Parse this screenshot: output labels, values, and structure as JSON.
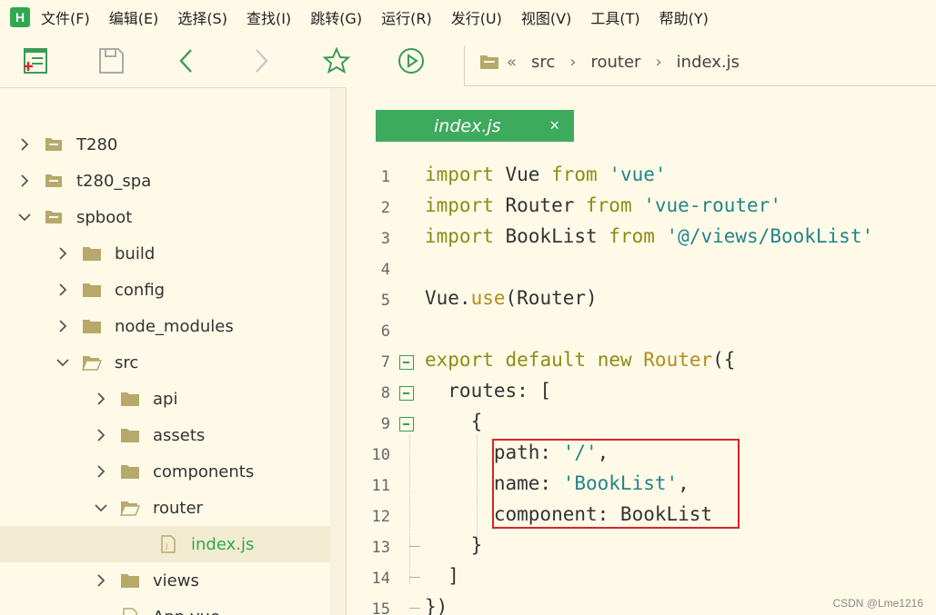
{
  "menu": {
    "logo": "H",
    "items": [
      "文件(F)",
      "编辑(E)",
      "选择(S)",
      "查找(I)",
      "跳转(G)",
      "运行(R)",
      "发行(U)",
      "视图(V)",
      "工具(T)",
      "帮助(Y)"
    ]
  },
  "toolbar": {
    "icons": [
      "new-file-icon",
      "save-icon",
      "back-icon",
      "forward-icon",
      "favorite-star-icon",
      "run-icon"
    ]
  },
  "breadcrumb": {
    "sep_left": "«",
    "items": [
      "src",
      "router",
      "index.js"
    ],
    "sep": "›"
  },
  "tree": [
    {
      "label": "T280",
      "depth": 0,
      "type": "project",
      "expanded": false
    },
    {
      "label": "t280_spa",
      "depth": 0,
      "type": "project",
      "expanded": false
    },
    {
      "label": "spboot",
      "depth": 0,
      "type": "project",
      "expanded": true
    },
    {
      "label": "build",
      "depth": 1,
      "type": "folder",
      "expanded": false
    },
    {
      "label": "config",
      "depth": 1,
      "type": "folder",
      "expanded": false
    },
    {
      "label": "node_modules",
      "depth": 1,
      "type": "folder",
      "expanded": false
    },
    {
      "label": "src",
      "depth": 1,
      "type": "folder",
      "expanded": true
    },
    {
      "label": "api",
      "depth": 2,
      "type": "folder",
      "expanded": false
    },
    {
      "label": "assets",
      "depth": 2,
      "type": "folder",
      "expanded": false
    },
    {
      "label": "components",
      "depth": 2,
      "type": "folder",
      "expanded": false
    },
    {
      "label": "router",
      "depth": 2,
      "type": "folder",
      "expanded": true
    },
    {
      "label": "index.js",
      "depth": 3,
      "type": "file",
      "selected": true
    },
    {
      "label": "views",
      "depth": 2,
      "type": "folder",
      "expanded": false
    },
    {
      "label": "App.vue",
      "depth": 2,
      "type": "file"
    }
  ],
  "tab": {
    "label": "index.js",
    "close": "×"
  },
  "code": {
    "line_numbers": [
      "1",
      "2",
      "3",
      "4",
      "5",
      "6",
      "7",
      "8",
      "9",
      "10",
      "11",
      "12",
      "13",
      "14",
      "15"
    ],
    "l1": [
      "import",
      " Vue ",
      "from",
      " ",
      "'vue'"
    ],
    "l2": [
      "import",
      " Router ",
      "from",
      " ",
      "'vue-router'"
    ],
    "l3": [
      "import",
      " BookList ",
      "from",
      " ",
      "'@/views/BookList'"
    ],
    "l5": [
      "Vue.",
      "use",
      "(Router)"
    ],
    "l7": [
      "export",
      " ",
      "default",
      " ",
      "new",
      " ",
      "Router",
      "({"
    ],
    "l8": "  routes: [",
    "l9": "    {",
    "l10": [
      "      path: ",
      "'/'",
      ","
    ],
    "l11": [
      "      name: ",
      "'BookList'",
      ","
    ],
    "l12": "      component: BookList",
    "l13": "    }",
    "l14": "  ]",
    "l15": "})"
  },
  "watermark": "CSDN @Lme1216",
  "colors": {
    "accent": "#3eaa5e",
    "keyword": "#8f8b12",
    "string": "#23848a",
    "highlight": "#d8242b",
    "background": "#fffae8"
  }
}
